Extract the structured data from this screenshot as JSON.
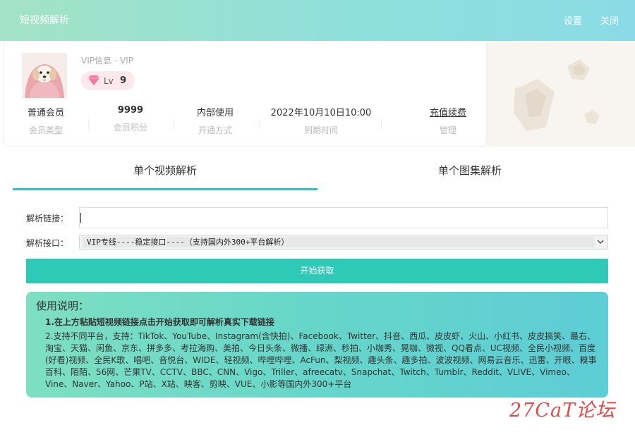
{
  "app": {
    "title": "短视频解析",
    "settings_label": "设置",
    "close_label": "关闭"
  },
  "user": {
    "vip_info": "VIP信息 - VIP",
    "level_prefix": "Lv",
    "level": "9",
    "stats": [
      {
        "value": "普通会员",
        "label": "会员类型"
      },
      {
        "value": "9999",
        "label": "会员积分"
      },
      {
        "value": "内部使用",
        "label": "开通方式"
      },
      {
        "value": "2022年10月10日10:00",
        "label": "到期时间"
      },
      {
        "value": "充值续费",
        "label": "管理"
      }
    ]
  },
  "tabs": [
    {
      "label": "单个视频解析",
      "active": true
    },
    {
      "label": "单个图集解析",
      "active": false
    }
  ],
  "form": {
    "url_label": "解析链接：",
    "url_value": "",
    "api_label": "解析接口：",
    "api_selected": "VIP专线----稳定接口----（支持国内外300+平台解析）",
    "submit_label": "开始获取"
  },
  "instructions": {
    "heading": "使用说明：",
    "line1": "1.在上方粘贴短视频链接点击开始获取即可解析真实下载链接",
    "line2": "2.支持不同平台，支持：TikTok、YouTube、Instagram(含快拍)、Facebook、Twitter、抖音、西瓜、皮皮虾、火山、小红书、皮皮搞笑、最右、淘宝、天猫、闲鱼、京东、拼多多、考拉海购、美拍、今日头条、微播、绿洲、秒拍、小咖秀、晃咖、微视、QQ看点、UC视频、全民小视频、百度(好看)视频、全民K歌、唱吧、音悦台、WIDE、轻视频、哔哩哔哩、AcFun、梨视频、趣头条、趣多拍、波波视频、网易云音乐、迅雷、开眼、糗事百科、陌陌、56网、芒果TV、CCTV、BBC、CNN、Vigo、Triller、afreecatv、Snapchat、Twitch、Tumblr、Reddit、VLIVE、Vimeo、Vine、Naver、Yahoo、P站、X站、映客、剪映、VUE、小影等国内外300+平台"
  },
  "watermark": "27CaT论坛",
  "colors": {
    "accent": "#2fc9b7",
    "tab_underline": "#2fc5b4",
    "link": "#c05b8f",
    "badge_bg": "#fde8ee",
    "diamond": "#f07aa0"
  },
  "icons": {
    "avatar": "puppy-in-pink-towel",
    "level": "diamond-icon",
    "select": "chevron-down-icon",
    "decoration": "gem-shapes"
  }
}
